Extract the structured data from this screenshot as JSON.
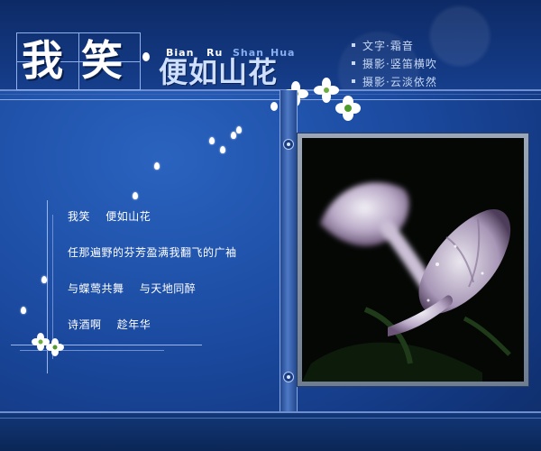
{
  "header": {
    "big_title_1": "我",
    "big_title_2": "笑",
    "sub_title": "便如山花",
    "pinyin": [
      "Bian",
      "Ru",
      "Shan",
      "Hua"
    ]
  },
  "credits": [
    "文字·霜音",
    "摄影·竖笛横吹",
    "摄影·云淡依然"
  ],
  "poem": [
    "我笑    便如山花",
    "任那遍野的芬芳盈满我翻飞的广袖",
    "与蝶莺共舞    与天地同醉",
    "诗酒啊    趁年华"
  ],
  "colors": {
    "background": "#1b4aa0",
    "accent": "#88aef0",
    "text": "#ffffff"
  }
}
